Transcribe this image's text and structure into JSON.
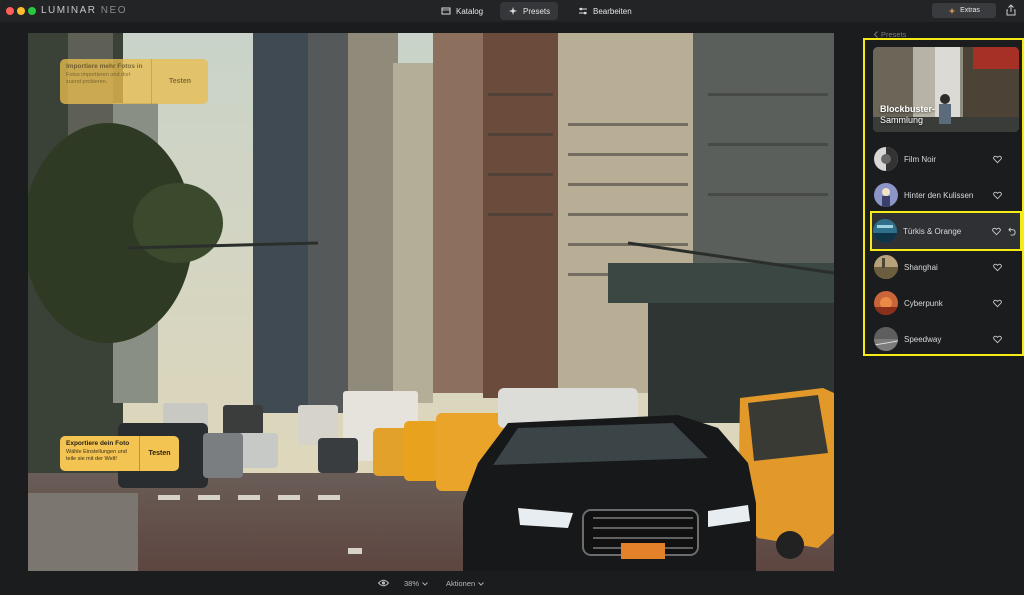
{
  "app": {
    "brand": "LUMINAR",
    "brand_suffix": "NEO"
  },
  "nav": {
    "tabs": [
      {
        "label": "Katalog",
        "icon": "catalog-icon",
        "active": false
      },
      {
        "label": "Presets",
        "icon": "presets-icon",
        "active": true
      },
      {
        "label": "Bearbeiten",
        "icon": "edit-sliders-icon",
        "active": false
      }
    ],
    "extras_label": "Extras"
  },
  "tips": {
    "top": {
      "title": "Importiere mehr Fotos in",
      "desc": "Fotos importieren und dort zuerst probieren.",
      "button": "Testen"
    },
    "bottom": {
      "title": "Exportiere dein Foto",
      "desc": "Wähle Einstellungen und teile sie mit der Welt!",
      "button": "Testen"
    }
  },
  "bottom": {
    "zoom": "38%",
    "actions": "Aktionen"
  },
  "panel": {
    "back_label": "Presets",
    "collection_title": "Blockbuster-",
    "collection_subtitle": "Sammlung",
    "presets": [
      {
        "name": "Film Noir",
        "selected": false
      },
      {
        "name": "Hinter den Kulissen",
        "selected": false
      },
      {
        "name": "Türkis & Orange",
        "selected": true
      },
      {
        "name": "Shanghai",
        "selected": false
      },
      {
        "name": "Cyberpunk",
        "selected": false
      },
      {
        "name": "Speedway",
        "selected": false
      }
    ]
  },
  "colors": {
    "highlight": "#f6eb16",
    "tip": "#f3c451",
    "taxi": "#e8a21e"
  }
}
